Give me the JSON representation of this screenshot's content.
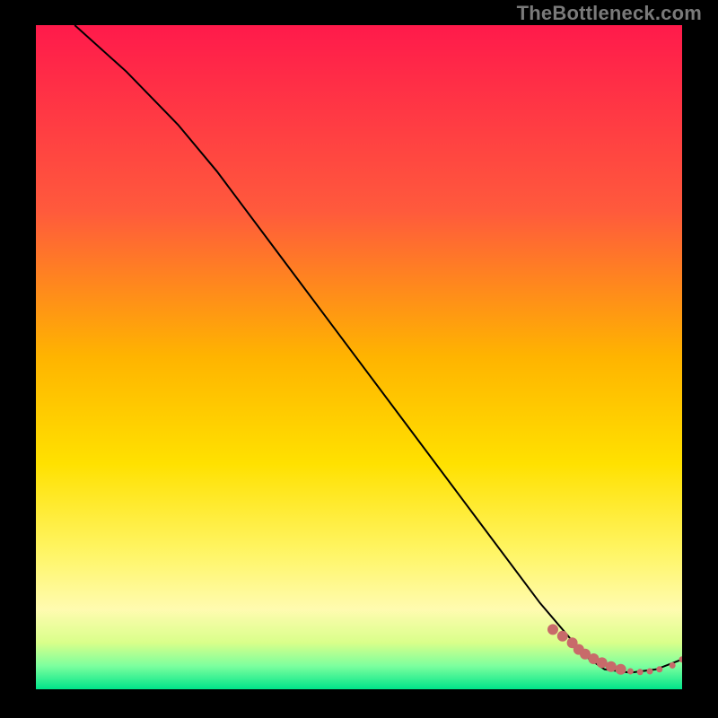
{
  "watermark": "TheBottleneck.com",
  "chart_data": {
    "type": "line",
    "title": "",
    "xlabel": "",
    "ylabel": "",
    "xlim": [
      0,
      100
    ],
    "ylim": [
      0,
      100
    ],
    "grid": false,
    "background_gradient": {
      "stops": [
        {
          "offset": 0,
          "color": "#ff1a4b"
        },
        {
          "offset": 28,
          "color": "#ff5a3c"
        },
        {
          "offset": 50,
          "color": "#ffb400"
        },
        {
          "offset": 66,
          "color": "#ffe100"
        },
        {
          "offset": 80,
          "color": "#fff66a"
        },
        {
          "offset": 88,
          "color": "#fffbb0"
        },
        {
          "offset": 93,
          "color": "#d9ff8a"
        },
        {
          "offset": 96.5,
          "color": "#7cff9e"
        },
        {
          "offset": 100,
          "color": "#00e58a"
        }
      ]
    },
    "series": [
      {
        "name": "curve",
        "color": "#000000",
        "x": [
          6,
          14,
          22,
          28,
          38,
          48,
          58,
          68,
          78,
          85,
          88,
          92,
          96,
          100
        ],
        "y": [
          100,
          93,
          85,
          78,
          65,
          52,
          39,
          26,
          13,
          5,
          3,
          2.5,
          3,
          4.5
        ]
      }
    ],
    "points": {
      "name": "cluster",
      "color": "#c86a6a",
      "size_large": 6,
      "size_small": 3.5,
      "x": [
        80,
        81.5,
        83,
        84,
        85,
        86.3,
        87.6,
        89,
        90.5,
        92,
        93.5,
        95,
        96.5,
        98.5,
        100
      ],
      "y": [
        9,
        8,
        7,
        6,
        5.3,
        4.6,
        4,
        3.4,
        3,
        2.7,
        2.6,
        2.7,
        3,
        3.6,
        4.5
      ],
      "large_indices": [
        0,
        1,
        2,
        3,
        4,
        5,
        6,
        7,
        8
      ],
      "small_indices": [
        9,
        10,
        11,
        12,
        13,
        14
      ]
    }
  }
}
